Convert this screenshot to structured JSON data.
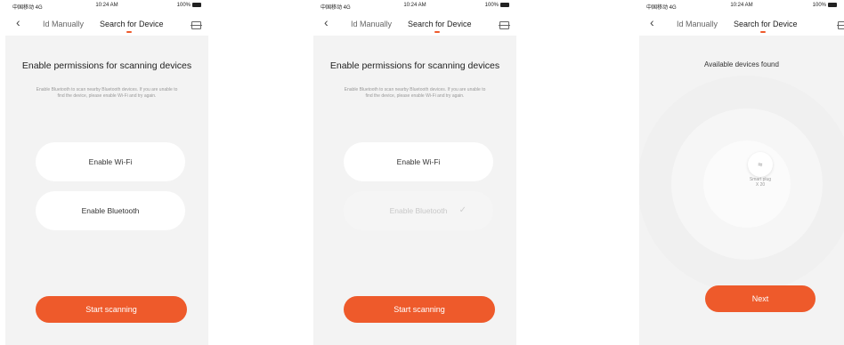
{
  "status_bar": {
    "carrier": "中国移动 4G",
    "time": "10:24 AM",
    "battery": "100%"
  },
  "nav": {
    "back_icon": "chevron-left-icon",
    "tab_manual": "Id Manually",
    "tab_search": "Search for Device",
    "scan_icon": "scan-icon"
  },
  "screens": [
    {
      "title": "Enable permissions for scanning devices",
      "description": "Enable Bluetooth to scan nearby Bluetooth devices. If you are unable to find the device, please enable Wi-Fi and try again.",
      "wifi_button": "Enable Wi-Fi",
      "bluetooth_button": "Enable Bluetooth",
      "cta": "Start scanning"
    },
    {
      "title": "Enable permissions for scanning devices",
      "description": "Enable Bluetooth to scan nearby Bluetooth devices. If you are unable to find the device, please enable Wi-Fi and try again.",
      "wifi_button": "Enable Wi-Fi",
      "bluetooth_button": "Enable Bluetooth",
      "bluetooth_check": "✓",
      "cta": "Start scanning"
    },
    {
      "found_title": "Available devices found",
      "device_icon": "wifi-icon",
      "device_glyph": "≈",
      "device_name": "Smart plug",
      "device_id": "X 20",
      "cta": "Next"
    }
  ],
  "colors": {
    "accent": "#ee5a2b",
    "background": "#f3f3f3"
  }
}
